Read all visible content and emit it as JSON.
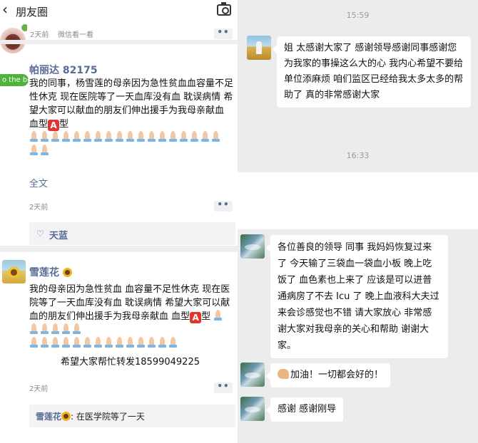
{
  "moments": {
    "title": "朋友圈",
    "top_item": {
      "time": "2天前",
      "visibility": "微信看一看",
      "badge": "o the bes"
    },
    "post1": {
      "author": "帕丽达 82175",
      "text": "我的同事，杨雪莲的母亲因为急性贫血血容量不足性休克 现在医院等了一天血库没有血 耽误病情 希望大家可以献血的朋友们伸出援手为我母亲献血 血型",
      "blood_type": "A",
      "fulltext_label": "全文",
      "time": "2天前",
      "likes": "天蓝"
    },
    "post2": {
      "author": "雪莲花",
      "text": "我的母亲因为急性贫血 血容量不足性休克 现在医院等了一天血库没有血 耽误病情 希望大家可以献血的朋友们伸出援手为我母亲献血 血型",
      "blood_type": "A",
      "extra": "希望大家帮忙转发18599049225",
      "time": "2天前",
      "comment_author": "雪莲花",
      "comment_text": ": 在医学院等了一天"
    }
  },
  "chat": {
    "time1": "15:59",
    "msg1": "姐 太感谢大家了 感谢领导感谢同事感谢您 为我家的事操这么大的心 我内心希望不要给单位添麻烦 咱们监区已经给我太多太多的帮助了 真的非常感谢大家",
    "time2": "16:33",
    "msg2": "各位善良的领导 同事 我妈妈恢复过来了 今天输了三袋血一袋血小板 晚上吃饭了 血色素也上来了 应该是可以进普通病房了不去 Icu 了  晚上血液科大夫过来会诊感觉也不错 请大家放心 非常感谢大家对我母亲的关心和帮助 谢谢大家。",
    "msg3": "加油！一切都会好的！",
    "msg4": "感谢 感谢刚导"
  }
}
